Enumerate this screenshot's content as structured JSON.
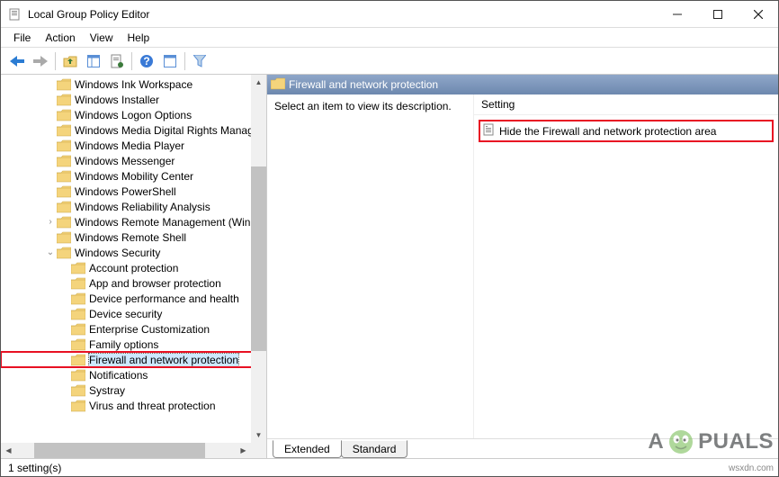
{
  "window": {
    "title": "Local Group Policy Editor"
  },
  "menu": {
    "file": "File",
    "action": "Action",
    "view": "View",
    "help": "Help"
  },
  "tree": {
    "items": [
      {
        "indent": 3,
        "expander": "",
        "label": "Windows Ink Workspace"
      },
      {
        "indent": 3,
        "expander": "",
        "label": "Windows Installer"
      },
      {
        "indent": 3,
        "expander": "",
        "label": "Windows Logon Options"
      },
      {
        "indent": 3,
        "expander": "",
        "label": "Windows Media Digital Rights Manag"
      },
      {
        "indent": 3,
        "expander": "",
        "label": "Windows Media Player"
      },
      {
        "indent": 3,
        "expander": "",
        "label": "Windows Messenger"
      },
      {
        "indent": 3,
        "expander": "",
        "label": "Windows Mobility Center"
      },
      {
        "indent": 3,
        "expander": "",
        "label": "Windows PowerShell"
      },
      {
        "indent": 3,
        "expander": "",
        "label": "Windows Reliability Analysis"
      },
      {
        "indent": 3,
        "expander": ">",
        "label": "Windows Remote Management (Winl"
      },
      {
        "indent": 3,
        "expander": "",
        "label": "Windows Remote Shell"
      },
      {
        "indent": 3,
        "expander": "v",
        "label": "Windows Security"
      },
      {
        "indent": 4,
        "expander": "",
        "label": "Account protection"
      },
      {
        "indent": 4,
        "expander": "",
        "label": "App and browser protection"
      },
      {
        "indent": 4,
        "expander": "",
        "label": "Device performance and health"
      },
      {
        "indent": 4,
        "expander": "",
        "label": "Device security"
      },
      {
        "indent": 4,
        "expander": "",
        "label": "Enterprise Customization"
      },
      {
        "indent": 4,
        "expander": "",
        "label": "Family options"
      },
      {
        "indent": 4,
        "expander": "",
        "label": "Firewall and network protection",
        "selected": true,
        "highlighted": true
      },
      {
        "indent": 4,
        "expander": "",
        "label": "Notifications"
      },
      {
        "indent": 4,
        "expander": "",
        "label": "Systray"
      },
      {
        "indent": 4,
        "expander": "",
        "label": "Virus and threat protection"
      }
    ]
  },
  "detail": {
    "header_title": "Firewall and network protection",
    "description_title": "Select an item to view its description.",
    "column_setting": "Setting",
    "settings": [
      {
        "label": "Hide the Firewall and network protection area",
        "highlight": true
      }
    ]
  },
  "tabs": {
    "extended": "Extended",
    "standard": "Standard"
  },
  "status": {
    "text": "1 setting(s)"
  },
  "watermark": {
    "brand_left": "A",
    "brand_right": "PUALS"
  },
  "attribution": "wsxdn.com"
}
